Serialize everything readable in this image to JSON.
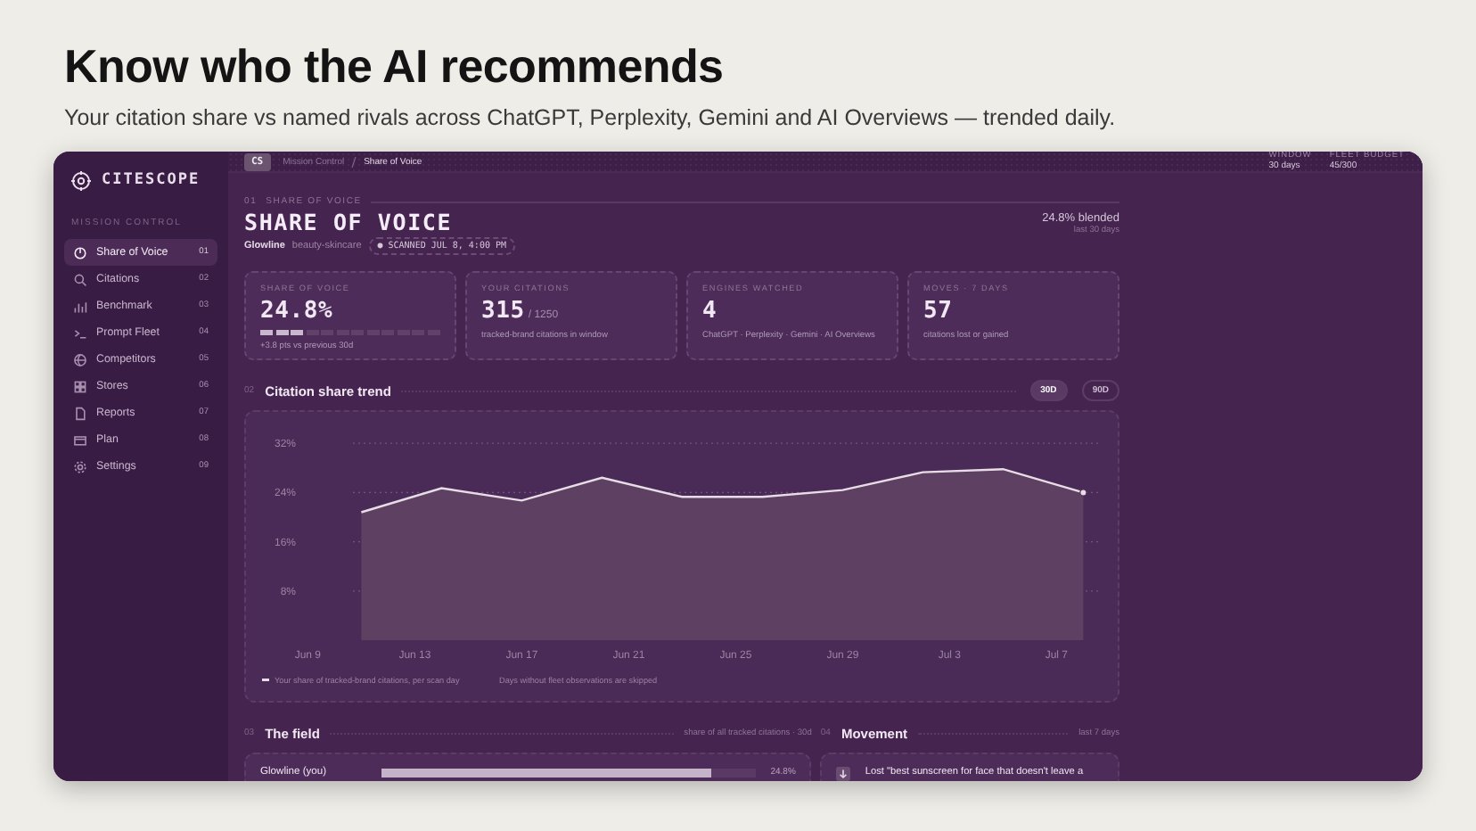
{
  "headline": "Know who the AI recommends",
  "subheadline": "Your citation share vs named rivals across ChatGPT, Perplexity, Gemini and AI Overviews — trended daily.",
  "app": {
    "brand": "CITESCOPE",
    "sidebar": {
      "section": "MISSION CONTROL",
      "items": [
        {
          "label": "Share of Voice",
          "shortcut": "01",
          "selected": true
        },
        {
          "label": "Citations",
          "shortcut": "02",
          "selected": false
        },
        {
          "label": "Benchmark",
          "shortcut": "03",
          "selected": false
        },
        {
          "label": "Prompt Fleet",
          "shortcut": "04",
          "selected": false
        },
        {
          "label": "Competitors",
          "shortcut": "05",
          "selected": false
        },
        {
          "label": "Stores",
          "shortcut": "06",
          "selected": false
        },
        {
          "label": "Reports",
          "shortcut": "07",
          "selected": false
        },
        {
          "label": "Plan",
          "shortcut": "08",
          "selected": false
        },
        {
          "label": "Settings",
          "shortcut": "09",
          "selected": false
        }
      ]
    },
    "topbar": {
      "badge": "CS",
      "breadcrumbs": [
        "Mission Control",
        "Share of Voice"
      ],
      "stats": [
        {
          "label": "WINDOW",
          "value": "30 days"
        },
        {
          "label": "FLEET BUDGET",
          "value": "45/300"
        }
      ]
    },
    "page": {
      "number": "01",
      "eyebrow": "SHARE OF VOICE",
      "title": "SHARE OF VOICE",
      "brand": "Glowline",
      "category": "beauty-skincare",
      "scan": "● SCANNED JUL 8, 4:00 PM",
      "blended": "24.8% blended",
      "blended_note": "last 30 days"
    },
    "cards": [
      {
        "kind": "segments",
        "label": "SHARE OF VOICE",
        "value": "24.8%",
        "level": 0.25,
        "note": "+3.8 pts vs previous 30d"
      },
      {
        "kind": "fraction",
        "label": "YOUR CITATIONS",
        "value": "315",
        "suffix": "/ 1250",
        "note": "tracked-brand citations in window"
      },
      {
        "kind": "plain",
        "label": "ENGINES WATCHED",
        "value": "4",
        "note": "ChatGPT · Perplexity · Gemini · AI Overviews"
      },
      {
        "kind": "plain",
        "label": "MOVES · 7 DAYS",
        "value": "57",
        "note": "citations lost or gained"
      }
    ],
    "trend": {
      "number": "02",
      "title": "Citation share trend",
      "ranges": [
        {
          "label": "30D",
          "selected": true
        },
        {
          "label": "90D",
          "selected": false
        }
      ],
      "chart_data": {
        "type": "area",
        "categories": [
          "Jun 9",
          null,
          null,
          null,
          "Jun 13",
          null,
          null,
          null,
          "Jun 17",
          null,
          null,
          null,
          "Jun 21",
          null,
          null,
          null,
          "Jun 25",
          null,
          null,
          null,
          "Jun 29",
          null,
          null,
          null,
          "Jul 3",
          null,
          null,
          null,
          "Jul 7",
          null
        ],
        "series": [
          {
            "name": "Your share of tracked-brand citations, per scan day",
            "color": "#e8dde6",
            "values": [
              null,
              null,
              20.8,
              null,
              null,
              24.7,
              null,
              null,
              22.7,
              null,
              null,
              26.4,
              null,
              null,
              23.3,
              null,
              null,
              23.3,
              null,
              null,
              24.4,
              null,
              null,
              27.3,
              null,
              null,
              27.8,
              null,
              null,
              24.0
            ]
          }
        ],
        "ylim": [
          0,
          32
        ],
        "grid": true,
        "yticks": [
          {
            "value": 8,
            "label": "8%"
          },
          {
            "value": 16,
            "label": "16%"
          },
          {
            "value": 24,
            "label": "24%"
          },
          {
            "value": 32,
            "label": "32%"
          }
        ]
      },
      "legend_note": "Days without fleet observations are skipped"
    },
    "field": {
      "number": "03",
      "title": "The field",
      "note": "share of all tracked citations · 30d",
      "rows": [
        {
          "name": "Glowline (you)",
          "level": 0.88,
          "value": "24.8%"
        }
      ]
    },
    "movement": {
      "number": "04",
      "title": "Movement",
      "note": "last 7 days",
      "items": [
        {
          "kind": "lost",
          "text": "Lost \"best sunscreen for face that doesn't leave a"
        }
      ]
    }
  }
}
